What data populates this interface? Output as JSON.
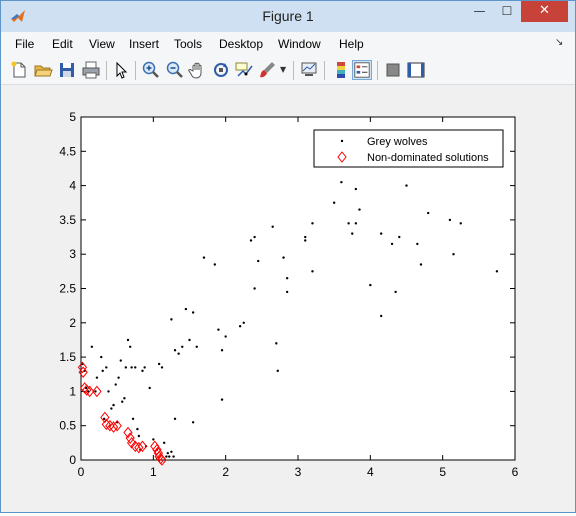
{
  "window": {
    "title": "Figure 1",
    "minimize_glyph": "—",
    "maximize_glyph": "☐",
    "close_glyph": "✕"
  },
  "menu": [
    {
      "label": "File"
    },
    {
      "label": "Edit"
    },
    {
      "label": "View"
    },
    {
      "label": "Insert"
    },
    {
      "label": "Tools"
    },
    {
      "label": "Desktop"
    },
    {
      "label": "Window"
    },
    {
      "label": "Help"
    }
  ],
  "toolbar_icons": [
    "new-figure-icon",
    "open-file-icon",
    "save-icon",
    "print-icon",
    "edit-plot-arrow-icon",
    "zoom-in-icon",
    "zoom-out-icon",
    "pan-hand-icon",
    "rotate-3d-icon",
    "data-cursor-icon",
    "brush-icon",
    "link-plot-icon",
    "insert-colorbar-icon",
    "insert-legend-icon",
    "hide-plot-tools-icon",
    "show-plot-tools-icon"
  ],
  "colors": {
    "titlebar": "#cfe0f2",
    "close_button": "#c7433a",
    "wolves": "#000000",
    "nondominated": "#ff0000"
  },
  "chart_data": {
    "type": "scatter",
    "xlim": [
      0,
      6
    ],
    "ylim": [
      0,
      5
    ],
    "xticks": [
      "0",
      "1",
      "2",
      "3",
      "4",
      "5",
      "6"
    ],
    "yticks": [
      "0",
      "0.5",
      "1",
      "1.5",
      "2",
      "2.5",
      "3",
      "3.5",
      "4",
      "4.5",
      "5"
    ],
    "grid": false,
    "legend_position": "top-right",
    "series": [
      {
        "name": "Grey wolves",
        "marker": "dot",
        "color": "#000000",
        "points": [
          [
            0.02,
            1.4
          ],
          [
            0.05,
            1.3
          ],
          [
            0.07,
            1.05
          ],
          [
            0.1,
            1.0
          ],
          [
            0.15,
            1.65
          ],
          [
            0.2,
            1.0
          ],
          [
            0.22,
            1.2
          ],
          [
            0.28,
            1.5
          ],
          [
            0.3,
            1.3
          ],
          [
            0.32,
            0.6
          ],
          [
            0.35,
            1.35
          ],
          [
            0.38,
            1.0
          ],
          [
            0.4,
            0.5
          ],
          [
            0.42,
            0.75
          ],
          [
            0.45,
            0.8
          ],
          [
            0.48,
            1.1
          ],
          [
            0.5,
            0.55
          ],
          [
            0.52,
            1.2
          ],
          [
            0.55,
            1.45
          ],
          [
            0.57,
            0.85
          ],
          [
            0.6,
            0.9
          ],
          [
            0.62,
            1.35
          ],
          [
            0.65,
            1.75
          ],
          [
            0.68,
            1.65
          ],
          [
            0.7,
            1.35
          ],
          [
            0.72,
            0.6
          ],
          [
            0.75,
            1.35
          ],
          [
            0.78,
            0.45
          ],
          [
            0.8,
            0.35
          ],
          [
            0.82,
            0.15
          ],
          [
            0.85,
            1.3
          ],
          [
            0.88,
            1.35
          ],
          [
            0.9,
            0.2
          ],
          [
            0.95,
            1.05
          ],
          [
            1.0,
            0.3
          ],
          [
            1.05,
            0.15
          ],
          [
            1.08,
            1.4
          ],
          [
            1.12,
            1.35
          ],
          [
            1.15,
            0.25
          ],
          [
            1.18,
            0.05
          ],
          [
            1.2,
            0.1
          ],
          [
            1.22,
            0.05
          ],
          [
            1.25,
            0.12
          ],
          [
            1.28,
            0.05
          ],
          [
            1.3,
            0.6
          ],
          [
            1.25,
            2.05
          ],
          [
            1.3,
            1.6
          ],
          [
            1.35,
            1.55
          ],
          [
            1.4,
            1.65
          ],
          [
            1.45,
            2.2
          ],
          [
            1.5,
            1.75
          ],
          [
            1.55,
            2.15
          ],
          [
            1.6,
            1.65
          ],
          [
            1.55,
            0.55
          ],
          [
            1.7,
            2.95
          ],
          [
            1.85,
            2.85
          ],
          [
            1.9,
            1.9
          ],
          [
            1.95,
            1.6
          ],
          [
            1.95,
            0.88
          ],
          [
            2.0,
            1.8
          ],
          [
            2.2,
            1.95
          ],
          [
            2.25,
            2.0
          ],
          [
            2.35,
            3.2
          ],
          [
            2.4,
            3.25
          ],
          [
            2.4,
            2.5
          ],
          [
            2.45,
            2.9
          ],
          [
            2.65,
            3.4
          ],
          [
            2.7,
            1.7
          ],
          [
            2.72,
            1.3
          ],
          [
            2.8,
            2.95
          ],
          [
            2.85,
            2.65
          ],
          [
            2.85,
            2.45
          ],
          [
            3.1,
            3.2
          ],
          [
            3.1,
            3.25
          ],
          [
            3.2,
            3.45
          ],
          [
            3.2,
            2.75
          ],
          [
            3.5,
            3.75
          ],
          [
            3.6,
            4.05
          ],
          [
            3.7,
            3.45
          ],
          [
            3.75,
            3.3
          ],
          [
            3.8,
            3.45
          ],
          [
            3.8,
            3.95
          ],
          [
            3.85,
            3.65
          ],
          [
            4.0,
            2.55
          ],
          [
            4.15,
            2.1
          ],
          [
            4.15,
            3.3
          ],
          [
            4.3,
            3.15
          ],
          [
            4.35,
            2.45
          ],
          [
            4.4,
            3.25
          ],
          [
            4.5,
            4.0
          ],
          [
            4.65,
            3.15
          ],
          [
            4.7,
            2.85
          ],
          [
            4.8,
            3.6
          ],
          [
            5.1,
            3.5
          ],
          [
            5.15,
            3.0
          ],
          [
            5.25,
            3.45
          ],
          [
            5.75,
            2.75
          ]
        ]
      },
      {
        "name": "Non-dominated solutions",
        "marker": "diamond",
        "color": "#ff0000",
        "points": [
          [
            0.02,
            1.35
          ],
          [
            0.03,
            1.28
          ],
          [
            0.05,
            1.05
          ],
          [
            0.08,
            1.02
          ],
          [
            0.12,
            1.0
          ],
          [
            0.22,
            1.0
          ],
          [
            0.33,
            0.62
          ],
          [
            0.35,
            0.52
          ],
          [
            0.4,
            0.5
          ],
          [
            0.45,
            0.48
          ],
          [
            0.5,
            0.5
          ],
          [
            0.65,
            0.4
          ],
          [
            0.68,
            0.32
          ],
          [
            0.7,
            0.25
          ],
          [
            0.75,
            0.2
          ],
          [
            0.8,
            0.18
          ],
          [
            0.85,
            0.2
          ],
          [
            1.02,
            0.2
          ],
          [
            1.05,
            0.15
          ],
          [
            1.07,
            0.1
          ],
          [
            1.08,
            0.05
          ],
          [
            1.1,
            0.02
          ],
          [
            1.12,
            0.0
          ]
        ]
      }
    ]
  }
}
